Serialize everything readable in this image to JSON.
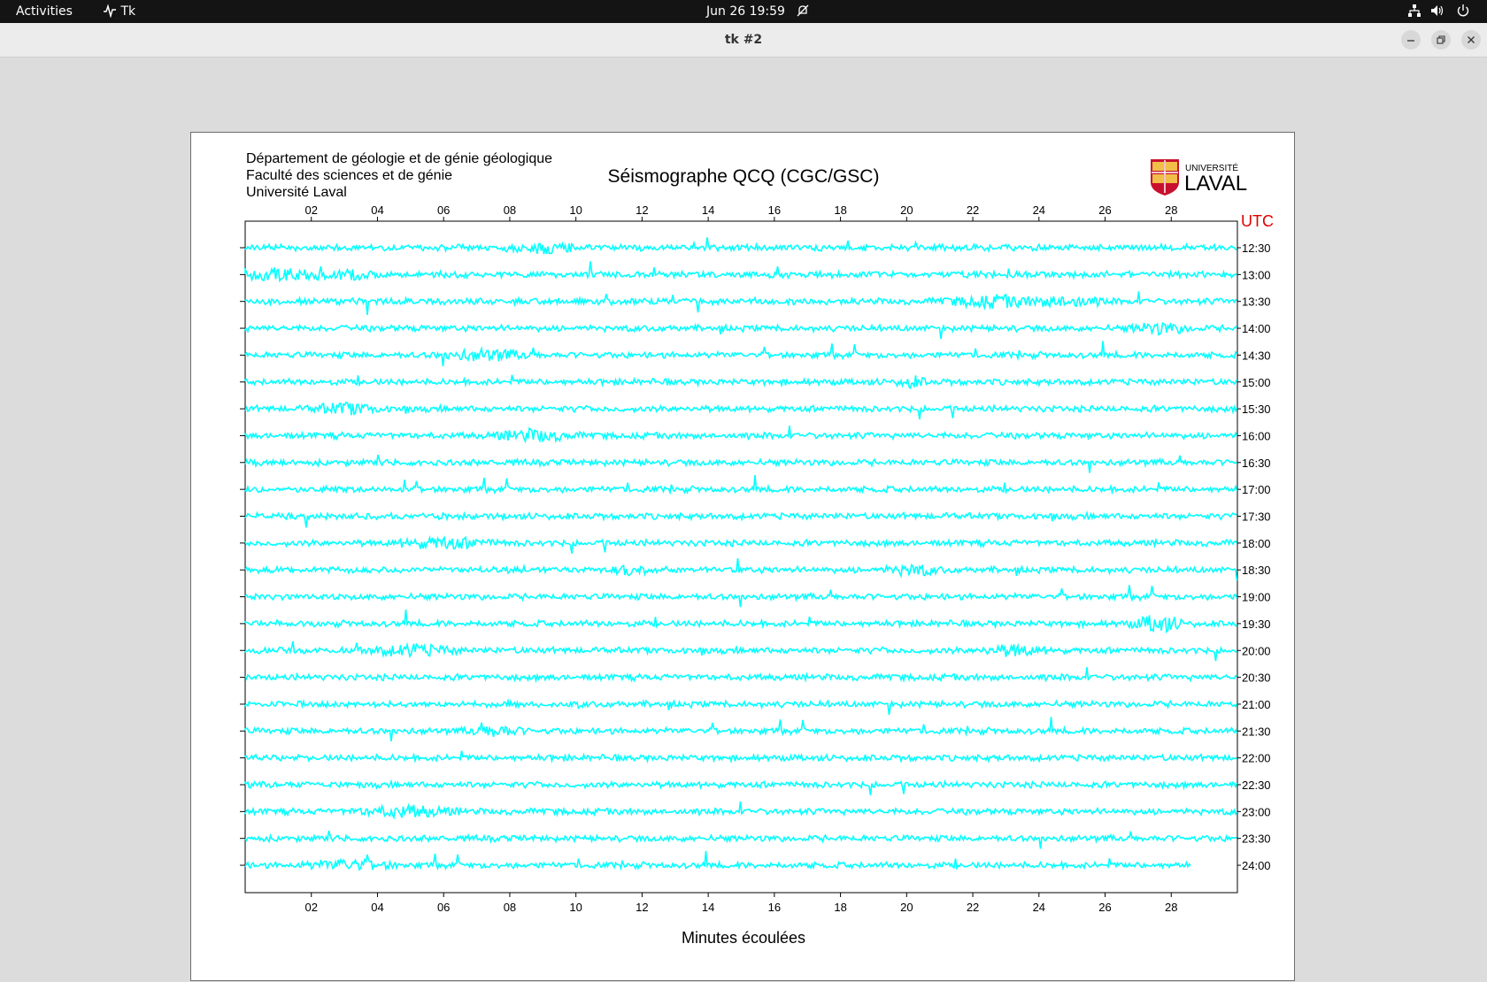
{
  "topbar": {
    "activities": "Activities",
    "app_name": "Tk",
    "datetime": "Jun 26  19:59"
  },
  "window": {
    "title": "tk #2"
  },
  "header": {
    "line1": "Département de géologie et de génie géologique",
    "line2": "Faculté des sciences et de génie",
    "line3": "Université Laval",
    "logo_top": "UNIVERSITÉ",
    "logo_main": "LAVAL"
  },
  "chart_data": {
    "type": "line",
    "title": "Séismographe QCQ (CGC/GSC)",
    "xlabel": "Minutes écoulées",
    "ylabel": "UTC",
    "xlim": [
      0,
      30
    ],
    "x_ticks": [
      "02",
      "04",
      "06",
      "08",
      "10",
      "12",
      "14",
      "16",
      "18",
      "20",
      "22",
      "24",
      "26",
      "28"
    ],
    "y_labels": [
      "12:30",
      "13:00",
      "13:30",
      "14:00",
      "14:30",
      "15:00",
      "15:30",
      "16:00",
      "16:30",
      "17:00",
      "17:30",
      "18:00",
      "18:30",
      "19:00",
      "19:30",
      "20:00",
      "20:30",
      "21:00",
      "21:30",
      "22:00",
      "22:30",
      "23:00",
      "23:30",
      "24:00"
    ],
    "trace_color": "#00ffff",
    "last_trace_end_minute": 28.6
  }
}
